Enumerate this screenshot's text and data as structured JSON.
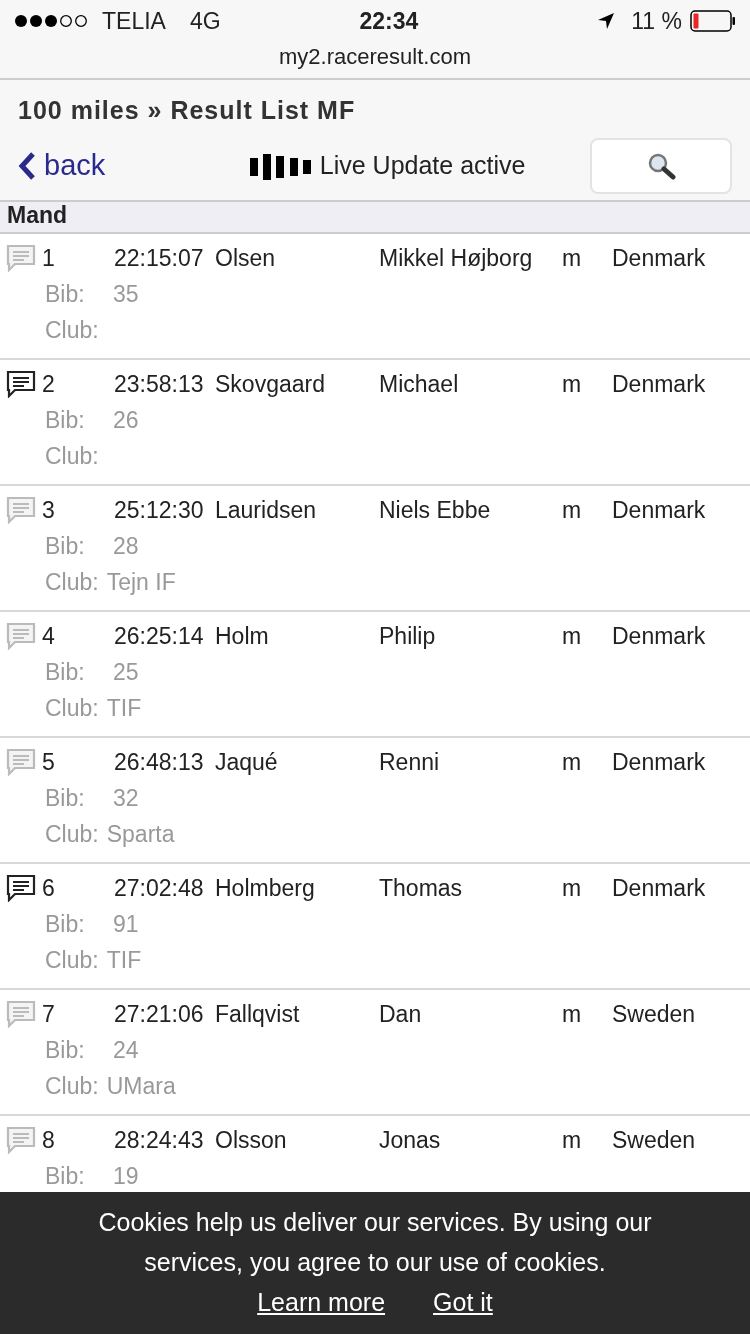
{
  "status_bar": {
    "carrier": "TELIA",
    "network": "4G",
    "time": "22:34",
    "battery": "11 %"
  },
  "address_bar": {
    "url": "my2.raceresult.com"
  },
  "header": {
    "title": "100 miles » Result List MF",
    "back": "back",
    "live_update": "Live Update active"
  },
  "group": {
    "title": "Mand"
  },
  "results": [
    {
      "rank": "1",
      "time": "22:15:07",
      "last_name": "Olsen",
      "first_name": "Mikkel Højborg",
      "sex": "m",
      "country": "Denmark",
      "bib_label": "Bib:",
      "bib": "35",
      "club_label": "Club:",
      "comment_active": false
    },
    {
      "rank": "2",
      "time": "23:58:13",
      "last_name": "Skovgaard",
      "first_name": "Michael",
      "sex": "m",
      "country": "Denmark",
      "bib_label": "Bib:",
      "bib": "26",
      "club_label": "Club:",
      "comment_active": true
    },
    {
      "rank": "3",
      "time": "25:12:30",
      "last_name": "Lauridsen",
      "first_name": "Niels Ebbe",
      "sex": "m",
      "country": "Denmark",
      "bib_label": "Bib:",
      "bib": "28",
      "club_label": "Club:",
      "club": "Tejn IF",
      "comment_active": false
    },
    {
      "rank": "4",
      "time": "26:25:14",
      "last_name": "Holm",
      "first_name": "Philip",
      "sex": "m",
      "country": "Denmark",
      "bib_label": "Bib:",
      "bib": "25",
      "club_label": "Club:",
      "club": "TIF",
      "comment_active": false
    },
    {
      "rank": "5",
      "time": "26:48:13",
      "last_name": "Jaqué",
      "first_name": "Renni",
      "sex": "m",
      "country": "Denmark",
      "bib_label": "Bib:",
      "bib": "32",
      "club_label": "Club:",
      "club": "Sparta",
      "comment_active": false
    },
    {
      "rank": "6",
      "time": "27:02:48",
      "last_name": "Holmberg",
      "first_name": "Thomas",
      "sex": "m",
      "country": "Denmark",
      "bib_label": "Bib:",
      "bib": "91",
      "club_label": "Club:",
      "club": "TIF",
      "comment_active": true
    },
    {
      "rank": "7",
      "time": "27:21:06",
      "last_name": "Fallqvist",
      "first_name": "Dan",
      "sex": "m",
      "country": "Sweden",
      "bib_label": "Bib:",
      "bib": "24",
      "club_label": "Club:",
      "club": "UMara",
      "comment_active": false
    },
    {
      "rank": "8",
      "time": "28:24:43",
      "last_name": "Olsson",
      "first_name": "Jonas",
      "sex": "m",
      "country": "Sweden",
      "bib_label": "Bib:",
      "bib": "19",
      "comment_active": false
    }
  ],
  "cookie_banner": {
    "message": "Cookies help us deliver our services. By using our services, you agree to our use of cookies.",
    "learn_more": "Learn more",
    "accept": "Got it"
  }
}
